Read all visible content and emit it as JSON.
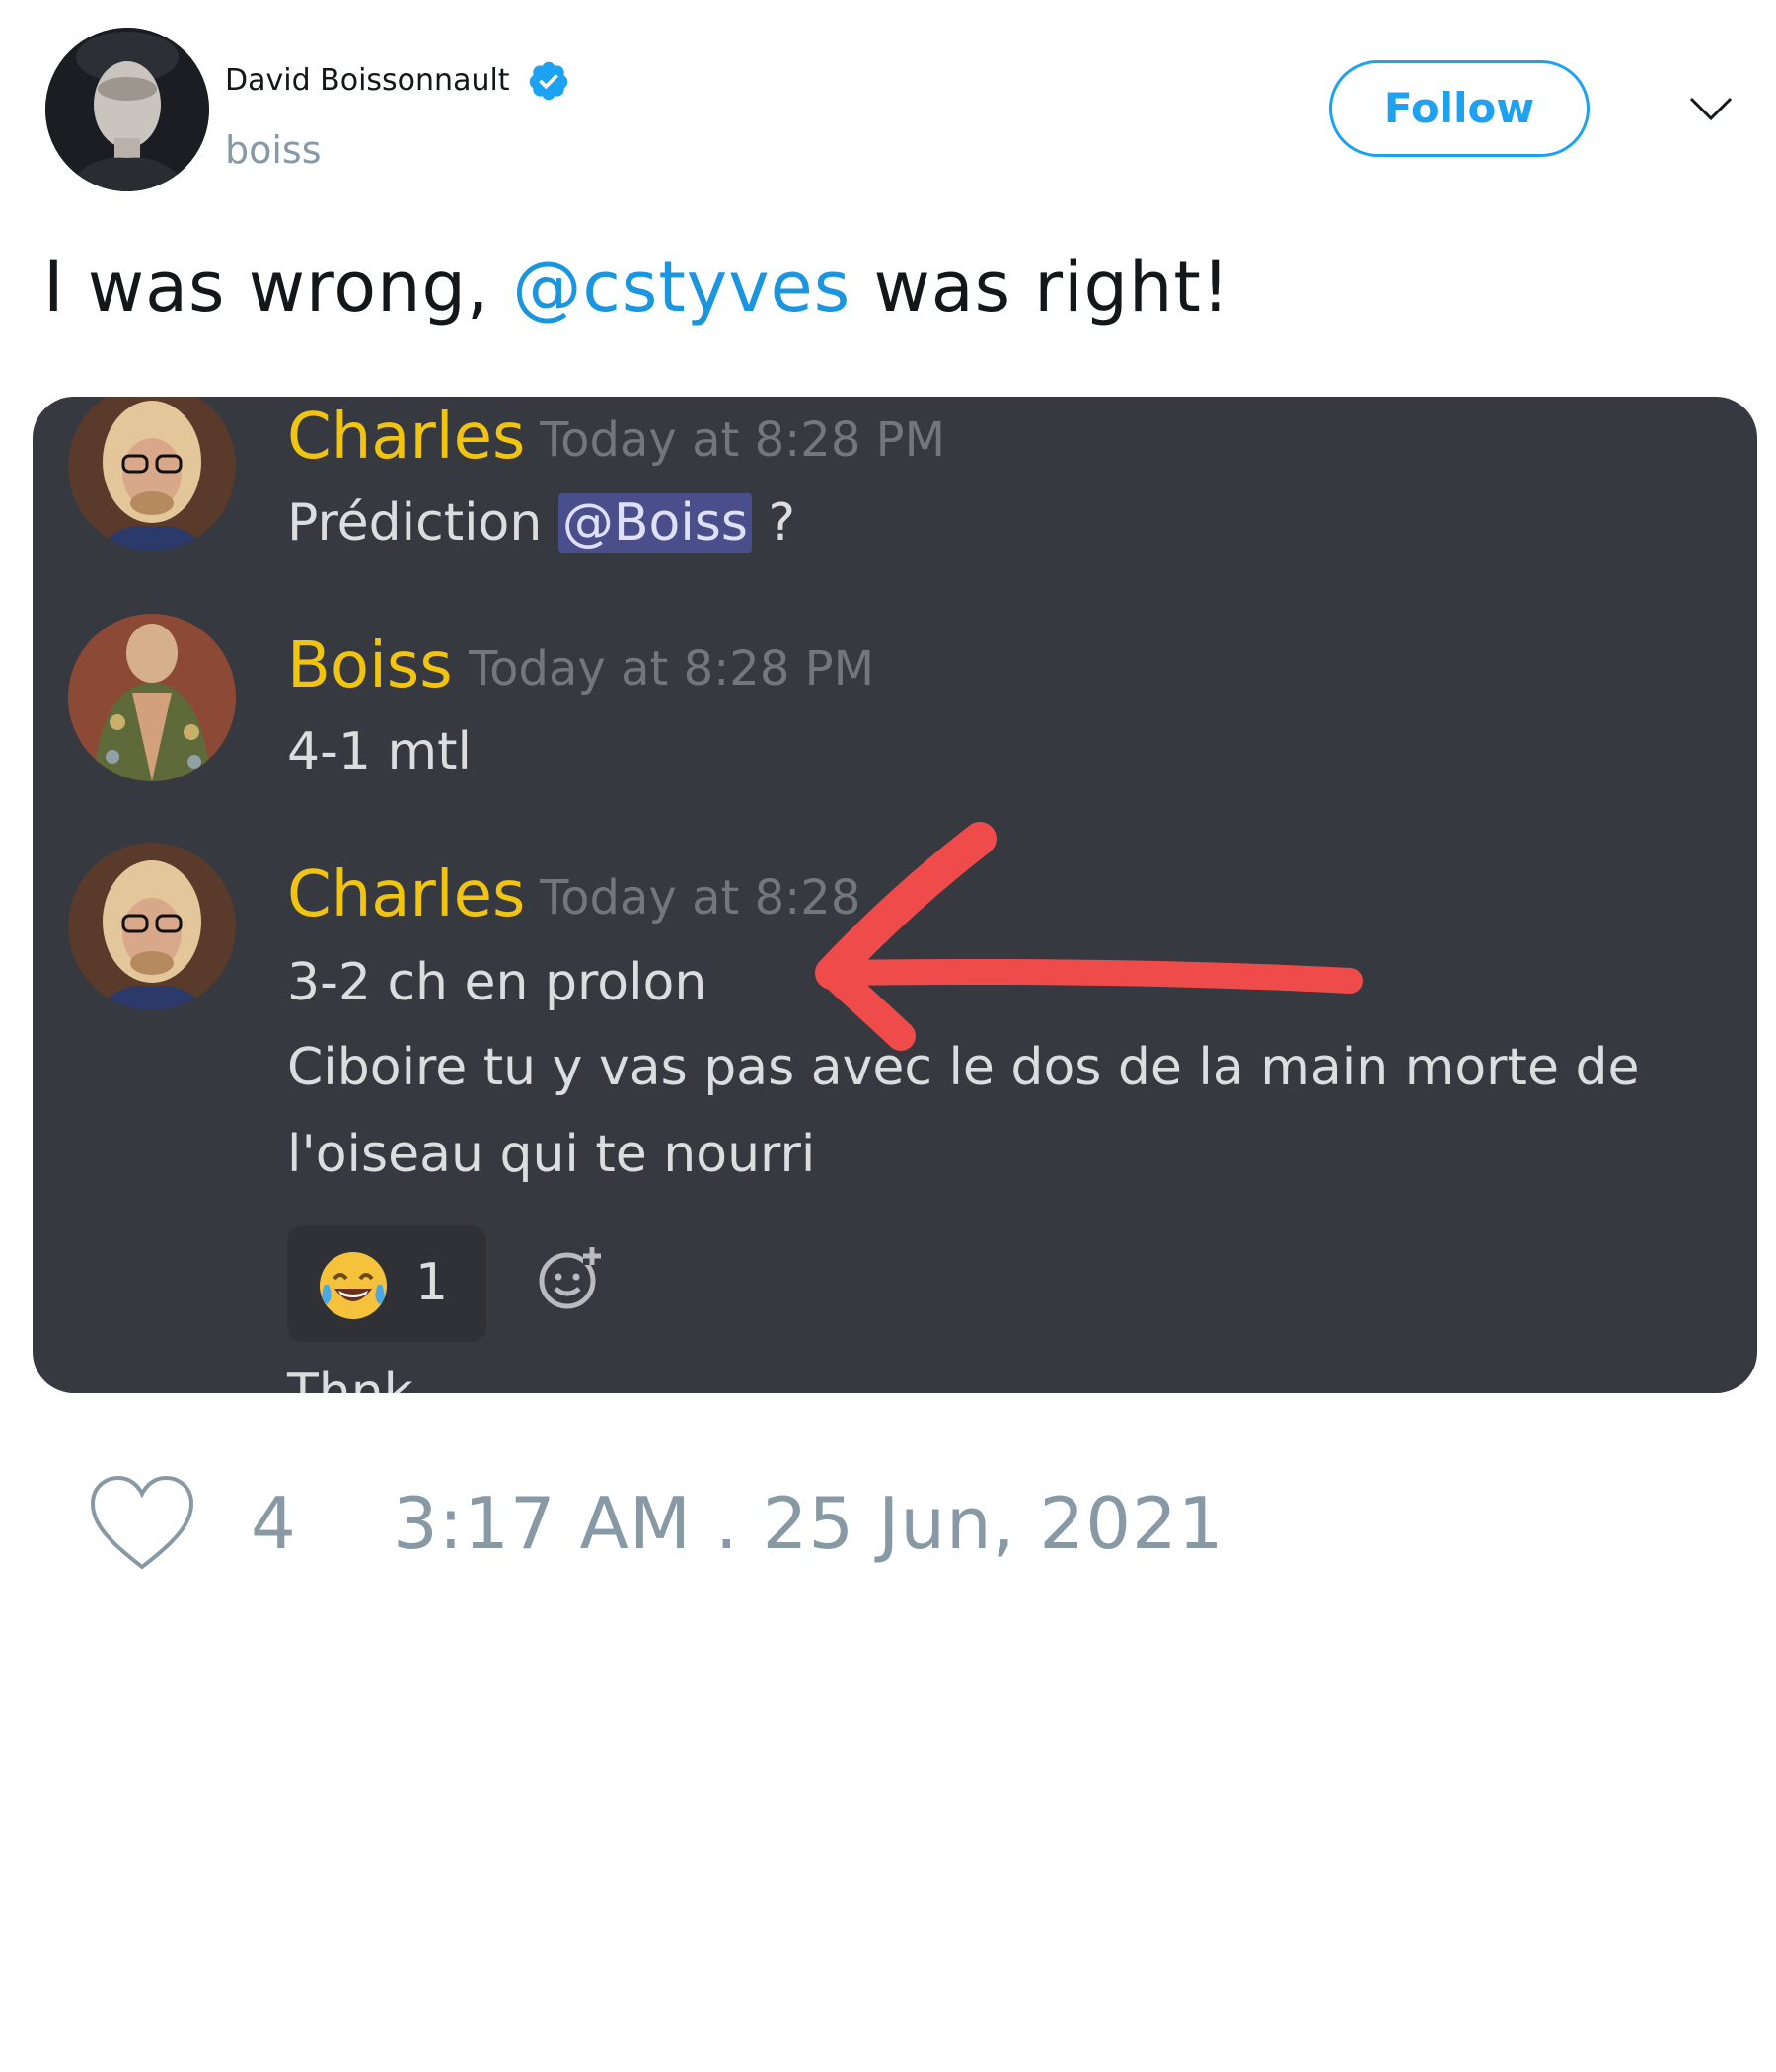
{
  "tweet": {
    "author": {
      "display_name": "David Boissonnault",
      "handle": "boiss",
      "verified_icon": "verified-badge-icon"
    },
    "follow_label": "Follow",
    "menu_icon": "chevron-down-icon",
    "text_before": "I was wrong, ",
    "mention": "@cstyves",
    "text_after": " was right!",
    "likes": "4",
    "timestamp": "3:17 AM . 25 Jun, 2021"
  },
  "screenshot": {
    "messages": [
      {
        "author": "Charles",
        "time": "Today at 8:28 PM",
        "text_prefix": "Prédiction ",
        "ping": "@Boiss",
        "text_suffix": " ?"
      },
      {
        "author": "Boiss",
        "time": "Today at 8:28 PM",
        "text": "4-1 mtl"
      },
      {
        "author": "Charles",
        "time": "Today at 8:28",
        "lines": [
          "3-2 ch en prolon",
          "Ciboire tu y vas pas avec le dos de la main morte de",
          "l'oiseau qui te nourri"
        ]
      }
    ],
    "reaction": {
      "emoji_icon": "tears-of-joy-emoji-icon",
      "count": "1"
    },
    "add_reaction_icon": "add-reaction-icon",
    "cut_off_text": "Thnk"
  },
  "colors": {
    "accent": "#1da1f2",
    "discord_bg": "#36393f",
    "username": "#f1c40f",
    "arrow": "#f04b4b"
  }
}
